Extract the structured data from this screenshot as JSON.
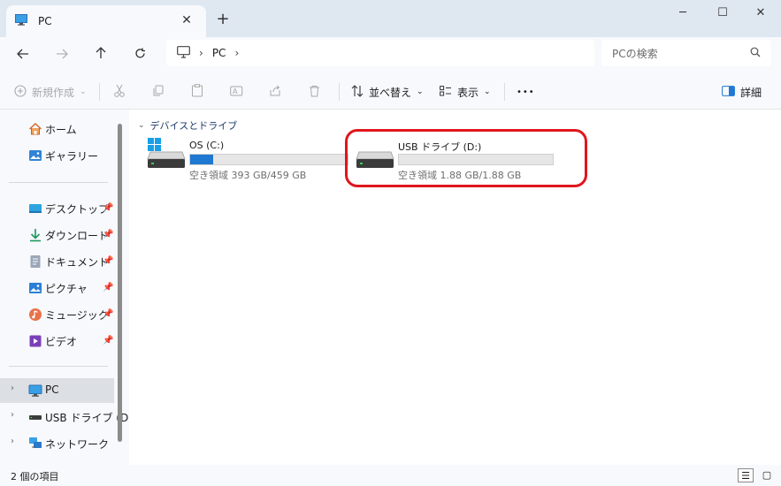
{
  "window": {
    "tab_title": "PC",
    "new_tab": "+",
    "minimize": "─",
    "maximize": "☐",
    "close": "✕"
  },
  "address": {
    "segments": [
      "PC"
    ],
    "search_placeholder": "PCの検索"
  },
  "toolbar": {
    "new_label": "新規作成",
    "sort_label": "並べ替え",
    "view_label": "表示",
    "more_label": "•••",
    "details_label": "詳細"
  },
  "sidebar": {
    "home": "ホーム",
    "gallery": "ギャラリー",
    "quick": [
      {
        "label": "デスクトップ"
      },
      {
        "label": "ダウンロード"
      },
      {
        "label": "ドキュメント"
      },
      {
        "label": "ピクチャ"
      },
      {
        "label": "ミュージック"
      },
      {
        "label": "ビデオ"
      }
    ],
    "tree": [
      {
        "label": "PC"
      },
      {
        "label": "USB ドライブ (D:)"
      },
      {
        "label": "ネットワーク"
      }
    ]
  },
  "content": {
    "group_title": "デバイスとドライブ",
    "drives": [
      {
        "name": "OS (C:)",
        "space": "空き領域 393 GB/459 GB",
        "used_fraction": 0.144
      },
      {
        "name": "USB ドライブ (D:)",
        "space": "空き領域 1.88 GB/1.88 GB",
        "used_fraction": 0.0
      }
    ]
  },
  "status": {
    "item_count": "2 個の項目"
  },
  "colors": {
    "accent": "#1f78d1",
    "highlight": "#e0161d"
  }
}
